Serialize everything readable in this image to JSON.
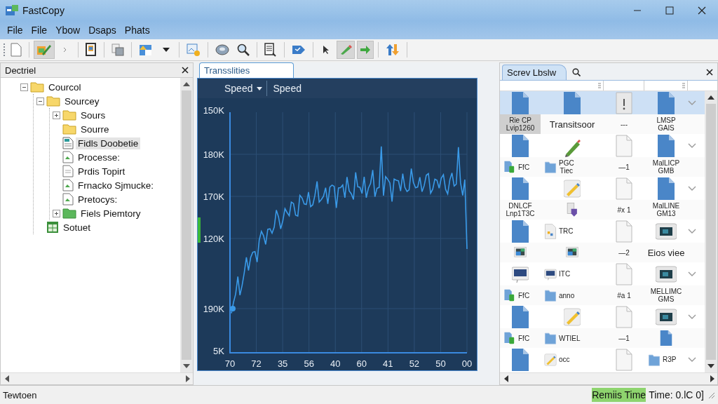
{
  "window": {
    "title": "FastCopy"
  },
  "menu": [
    "File",
    "File",
    "Ybow",
    "Dsaps",
    "Phats"
  ],
  "toolbar": [
    [
      {
        "kind": "page",
        "pressed": false
      }
    ],
    [
      {
        "kind": "edit",
        "pressed": true
      },
      {
        "kind": "chevron",
        "pressed": false
      }
    ],
    [
      {
        "kind": "book",
        "pressed": false
      }
    ],
    [
      {
        "kind": "copy",
        "pressed": false
      }
    ],
    [
      {
        "kind": "picture",
        "pressed": false
      },
      {
        "kind": "caret",
        "pressed": false
      }
    ],
    [
      {
        "kind": "image-edit",
        "pressed": false
      }
    ],
    [
      {
        "kind": "disk",
        "pressed": false
      },
      {
        "kind": "search",
        "pressed": false
      }
    ],
    [
      {
        "kind": "list",
        "pressed": false
      }
    ],
    [
      {
        "kind": "tag",
        "pressed": false
      }
    ],
    [
      {
        "kind": "pointer",
        "pressed": false
      },
      {
        "kind": "green-pencil",
        "pressed": true
      },
      {
        "kind": "green-arrow",
        "pressed": true
      }
    ],
    [
      {
        "kind": "swap",
        "pressed": false
      }
    ]
  ],
  "left_pane": {
    "title": "Dectriel",
    "tree": [
      {
        "label": "Courcol",
        "kind": "folder",
        "expanded": true,
        "selected": false,
        "children": [
          {
            "label": "Sourcey",
            "kind": "folder",
            "expanded": true,
            "selected": false,
            "children": [
              {
                "label": "Sours",
                "kind": "folder",
                "expanded": false,
                "selected": false
              },
              {
                "label": "Sourre",
                "kind": "folder",
                "selected": false
              },
              {
                "label": "Fidls Doobetie",
                "kind": "document",
                "selected": true
              },
              {
                "label": "Processe:",
                "kind": "sheet",
                "selected": false
              },
              {
                "label": "Prdis Topirt",
                "kind": "page",
                "selected": false
              },
              {
                "label": "Frnacko Sjmucke:",
                "kind": "sheet",
                "selected": false
              },
              {
                "label": "Pretocys:",
                "kind": "sheet",
                "selected": false
              },
              {
                "label": "Fiels Piemtory",
                "kind": "green-folder",
                "expanded": false,
                "selected": false
              }
            ]
          },
          {
            "label": "Sotuet",
            "kind": "spreadsheet",
            "selected": false
          }
        ]
      }
    ]
  },
  "center": {
    "tab": "Transslities",
    "legend": {
      "dropdown": "Speed",
      "label": "Speed"
    },
    "y_labels": [
      "150K",
      "180K",
      "170K",
      "120K",
      "190K",
      "5K"
    ],
    "x_labels": [
      "70",
      "72",
      "35",
      "56",
      "40",
      "60",
      "41",
      "52",
      "50",
      "00"
    ]
  },
  "right_pane": {
    "tab": "Screv Lbslw",
    "rows": [
      {
        "kind": "icons",
        "selected": true,
        "cells": [
          {
            "kind": "doc-blue",
            "selected": false
          },
          {
            "kind": "doc-blue",
            "selected": false
          },
          {
            "kind": "doc-gray",
            "selected": false
          },
          {
            "kind": "doc-blue",
            "selected": false
          }
        ]
      },
      {
        "kind": "labels",
        "selected": false,
        "cells": [
          {
            "text": "Rie CP\nLvip1260",
            "selected": true
          },
          {
            "text": "Transitsoor",
            "selected": false
          },
          {
            "text": "---",
            "selected": false
          },
          {
            "text": "LMSP\nGAlS",
            "selected": false
          }
        ]
      },
      {
        "kind": "icons",
        "selected": false,
        "cells": [
          {
            "kind": "doc-blue",
            "selected": false
          },
          {
            "kind": "pencil",
            "selected": false
          },
          {
            "kind": "doc-white",
            "selected": false
          },
          {
            "kind": "doc-blue",
            "selected": false
          }
        ]
      },
      {
        "kind": "labels",
        "selected": false,
        "cells": [
          {
            "kind": "file-stack",
            "text": "FfC",
            "selected": false
          },
          {
            "kind": "folder",
            "text": "PGC\nTiec",
            "selected": false
          },
          {
            "text": "—1",
            "selected": false
          },
          {
            "text": "MalLICP\nGMB",
            "selected": false
          }
        ]
      },
      {
        "kind": "icons",
        "selected": false,
        "cells": [
          {
            "kind": "doc-blue",
            "selected": false
          },
          {
            "kind": "marker",
            "selected": false
          },
          {
            "kind": "doc-white",
            "selected": false
          },
          {
            "kind": "doc-blue",
            "selected": false
          }
        ]
      },
      {
        "kind": "labels",
        "selected": false,
        "cells": [
          {
            "text": "DNLCF\nLnp1T3C",
            "selected": false
          },
          {
            "kind": "package",
            "selected": false
          },
          {
            "text": "#x 1",
            "selected": false
          },
          {
            "text": "MalLINE\nGM13",
            "selected": false
          }
        ]
      },
      {
        "kind": "icons",
        "selected": false,
        "cells": [
          {
            "kind": "doc-blue",
            "selected": false
          },
          {
            "kind": "page-edit",
            "text": "TRC",
            "selected": false
          },
          {
            "kind": "doc-white",
            "selected": false
          },
          {
            "kind": "screen-thumb",
            "selected": false
          }
        ]
      },
      {
        "kind": "labels",
        "selected": false,
        "cells": [
          {
            "kind": "screen",
            "selected": false
          },
          {
            "kind": "screen",
            "selected": false
          },
          {
            "text": "—2",
            "selected": false
          },
          {
            "text": "Eios viee",
            "selected": false
          }
        ]
      },
      {
        "kind": "icons",
        "selected": false,
        "cells": [
          {
            "kind": "monitor",
            "selected": false
          },
          {
            "kind": "monitor",
            "text": "ITC",
            "selected": false
          },
          {
            "kind": "doc-white",
            "selected": false
          },
          {
            "kind": "screen-thumb",
            "selected": false
          }
        ]
      },
      {
        "kind": "labels",
        "selected": false,
        "cells": [
          {
            "kind": "file-stack",
            "text": "FfC",
            "selected": false
          },
          {
            "kind": "folder",
            "text": "anno",
            "selected": false
          },
          {
            "text": "#a 1",
            "selected": false
          },
          {
            "text": "MELLIMC\nGMS",
            "selected": false
          }
        ]
      },
      {
        "kind": "icons",
        "selected": false,
        "cells": [
          {
            "kind": "doc-blue",
            "selected": false
          },
          {
            "kind": "marker",
            "selected": false
          },
          {
            "kind": "doc-white",
            "selected": false
          },
          {
            "kind": "screen-thumb",
            "selected": false
          }
        ]
      },
      {
        "kind": "labels",
        "selected": false,
        "cells": [
          {
            "kind": "file-stack",
            "text": "FfC",
            "selected": false
          },
          {
            "kind": "folder",
            "text": "WTIEL",
            "selected": false
          },
          {
            "text": "—1",
            "selected": false
          },
          {
            "kind": "doc-blue",
            "selected": false
          }
        ]
      },
      {
        "kind": "icons",
        "selected": false,
        "cells": [
          {
            "kind": "doc-blue",
            "selected": false
          },
          {
            "kind": "marker",
            "text": "occ",
            "selected": false
          },
          {
            "kind": "doc-white",
            "selected": false
          },
          {
            "kind": "folder",
            "text": "R3P",
            "selected": false
          }
        ]
      }
    ]
  },
  "status_bar": {
    "left": "Tewtoen",
    "highlight": "Remiis Time",
    "right": "Time: 0.lC 0]"
  }
}
